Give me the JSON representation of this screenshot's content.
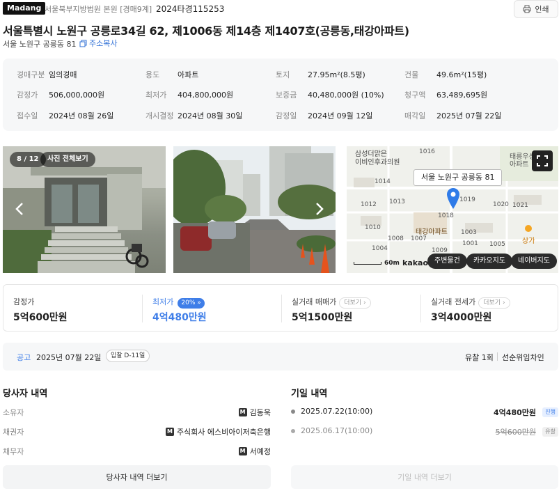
{
  "header": {
    "brand": "Madang",
    "court": "서울북부지방법원 본원 [경매9계]",
    "case_no": "2024타경115253",
    "print_label": "인쇄",
    "title": "서울특별시 노원구 공릉로34길 62, 제1006동 제14층 제1407호(공릉동,태강아파트)",
    "sub_address": "서울 노원구 공릉동 81",
    "copy_label": "주소복사"
  },
  "info": {
    "r1": [
      {
        "k": "경매구분",
        "v": "임의경매"
      },
      {
        "k": "용도",
        "v": "아파트"
      },
      {
        "k": "토지",
        "v": "27.95m²(8.5평)"
      },
      {
        "k": "건물",
        "v": "49.6m²(15평)"
      }
    ],
    "r2": [
      {
        "k": "감정가",
        "v": "506,000,000원"
      },
      {
        "k": "최저가",
        "v": "404,800,000원"
      },
      {
        "k": "보증금",
        "v": "40,480,000원 (10%)"
      },
      {
        "k": "청구액",
        "v": "63,489,695원"
      }
    ],
    "r3": [
      {
        "k": "접수일",
        "v": "2024년 08월 26일"
      },
      {
        "k": "개시결정",
        "v": "2024년 08월 30일"
      },
      {
        "k": "감정일",
        "v": "2024년 09월 12일"
      },
      {
        "k": "매각일",
        "v": "2025년 07월 22일"
      }
    ]
  },
  "photos": {
    "counter": "8 / 12",
    "view_all": "사진 전체보기"
  },
  "map": {
    "tooltip": "서울 노원구 공릉동 81",
    "labels": [
      "삼성더맑은",
      "이비인후과의원",
      "1016",
      "태릉우성",
      "아파트",
      "1014",
      "1013",
      "1019",
      "1020",
      "1021",
      "1012",
      "1018",
      "1010",
      "태강아파트",
      "1003",
      "1008",
      "1007",
      "1001",
      "1005",
      "1009",
      "1004",
      "상가"
    ],
    "scale": "60m",
    "brand": "kakao",
    "btn_nearby": "주변물건",
    "btn_kakao": "카카오지도",
    "btn_naver": "네이버지도"
  },
  "prices": {
    "appraisal": {
      "label": "감정가",
      "value": "5억600만원"
    },
    "minimum": {
      "label": "최저가",
      "badge": "20%",
      "value": "4억480만원"
    },
    "trade": {
      "label": "실거래 매매가",
      "more": "더보기",
      "value": "5억1500만원"
    },
    "lease": {
      "label": "실거래 전세가",
      "more": "더보기",
      "value": "3억4000만원"
    }
  },
  "notice": {
    "label": "공고",
    "date": "2025년 07월 22일",
    "dday": "입찰 D-11일",
    "fail": "유찰 1회",
    "lease_right": "선순위임차인"
  },
  "parties": {
    "title": "당사자 내역",
    "rows": [
      {
        "k": "소유자",
        "v": "김동욱"
      },
      {
        "k": "채권자",
        "v": "주식회사 에스비아이저축은행"
      },
      {
        "k": "채무자",
        "v": "서예정"
      }
    ],
    "more": "당사자 내역 더보기"
  },
  "history": {
    "title": "기일 내역",
    "rows": [
      {
        "date": "2025.07.22(10:00)",
        "price": "4억480만원",
        "status": "진행"
      },
      {
        "date": "2025.06.17(10:00)",
        "price": "5억600만원",
        "status": "유찰"
      }
    ],
    "more": "기일 내역 더보기"
  },
  "colors": {
    "accent": "#3f7ee8",
    "brand": "#111111",
    "panel": "#f6f7f8"
  }
}
